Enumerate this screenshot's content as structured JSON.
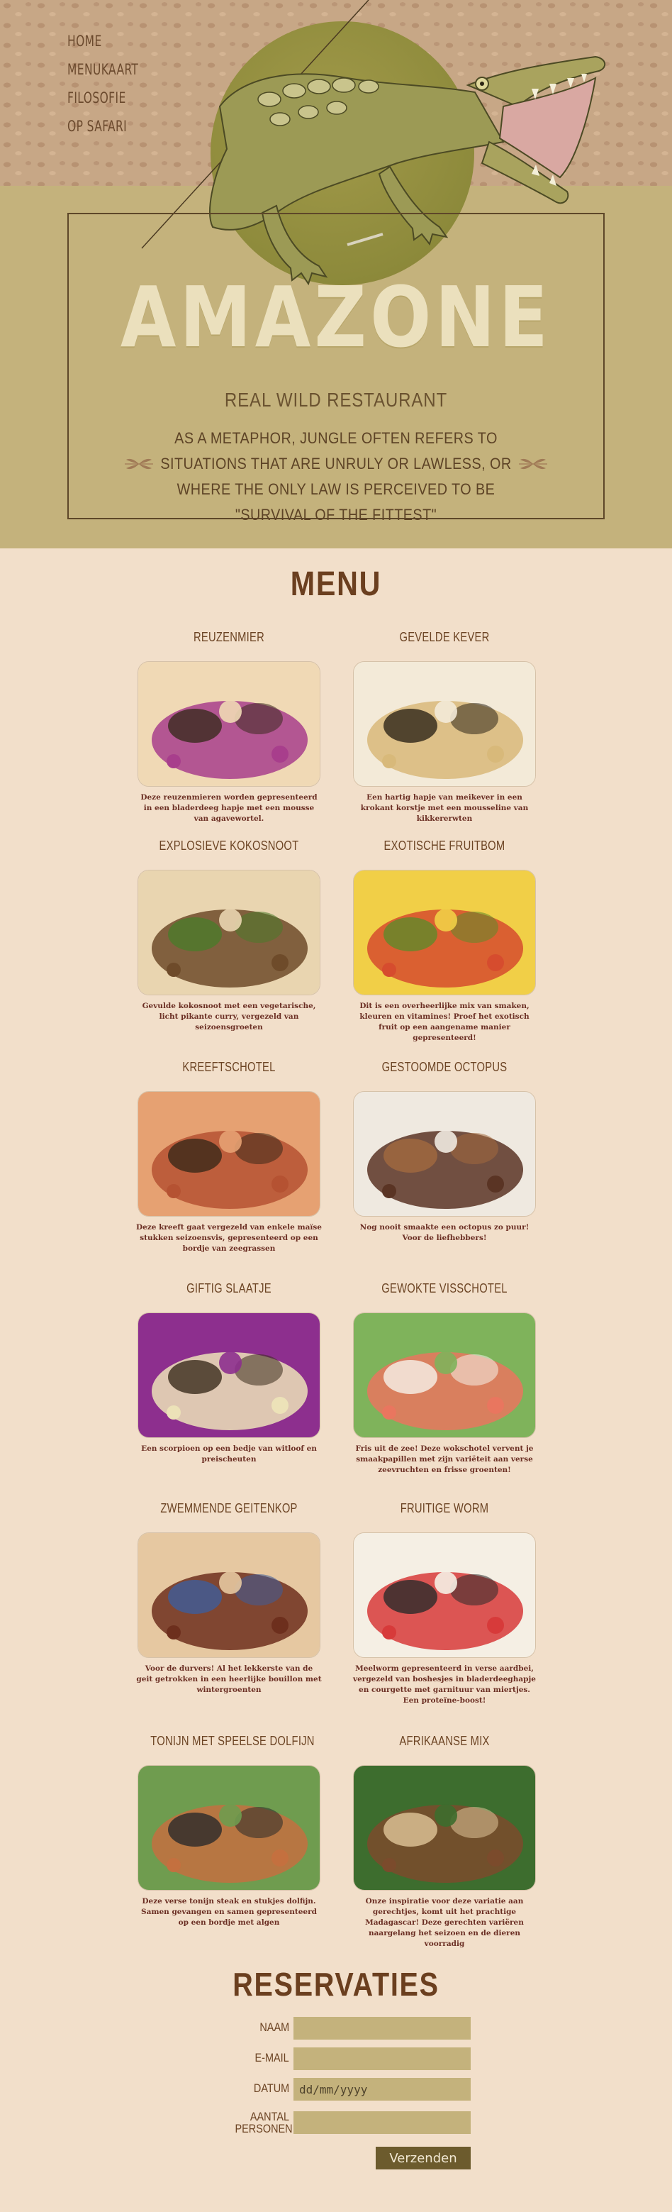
{
  "nav": {
    "items": [
      "HOME",
      "MENUKAART",
      "FILOSOFIE",
      "OP SAFARI"
    ]
  },
  "hero": {
    "title": "AMAZONE",
    "subtitle": "REAL WILD RESTAURANT",
    "quote": "AS A METAPHOR, JUNGLE OFTEN REFERS TO SITUATIONS THAT ARE UNRULY OR LAWLESS, OR WHERE THE ONLY LAW IS PERCEIVED TO BE \"SURVIVAL OF THE FITTEST\""
  },
  "menu": {
    "heading": "MENU",
    "dishes": [
      {
        "name": "REUZENMIER",
        "description": "Deze reuzenmieren worden gepresenteerd in een bladerdeeg hapje met een mousse van agavewortel."
      },
      {
        "name": "GEVELDE KEVER",
        "description": "Een hartig hapje van meikever in een krokant korstje met een mousseline van kikkererwten"
      },
      {
        "name": "EXPLOSIEVE KOKOSNOOT",
        "description": "Gevulde kokosnoot met een vegetarische, licht pikante curry, vergezeld van seizoensgroeten"
      },
      {
        "name": "EXOTISCHE FRUITBOM",
        "description": "Dit is een overheerlijke mix van smaken, kleuren en vitamines! Proef het exotisch fruit op een aangename manier gepresenteerd!"
      },
      {
        "name": "KREEFTSCHOTEL",
        "description": "Deze kreeft gaat vergezeld van enkele maïse stukken seizoensvis, gepresenteerd op een bordje van zeegrassen"
      },
      {
        "name": "GESTOOMDE OCTOPUS",
        "description": "Nog nooit smaakte een octopus zo puur! Voor de liefhebbers!"
      },
      {
        "name": "GIFTIG SLAATJE",
        "description": "Een scorpioen op een bedje van witloof en preischeuten"
      },
      {
        "name": "GEWOKTE VISSCHOTEL",
        "description": "Fris uit de zee! Deze wokschotel vervent je smaakpapillen met zijn variëteit aan verse zeevruchten en frisse groenten!"
      },
      {
        "name": "ZWEMMENDE GEITENKOP",
        "description": "Voor de durvers! Al het lekkerste van de geit getrokken in een heerlijke bouillon met wintergroenten"
      },
      {
        "name": "FRUITIGE WORM",
        "description": "Meelworm gepresenteerd in verse aardbei, vergezeld van boshesjes in bladerdeeghapje en courgette met garnituur van miertjes. Een proteïne-boost!"
      },
      {
        "name": "TONIJN MET SPEELSE DOLFIJN",
        "description": "Deze verse tonijn steak en stukjes dolfijn. Samen gevangen en samen gepresenteerd op een bordje met algen"
      },
      {
        "name": "AFRIKAANSE MIX",
        "description": "Onze inspiratie voor deze variatie aan gerechtjes, komt uit het prachtige Madagascar! Deze gerechten variëren naargelang het seizoen en de dieren voorradig"
      }
    ]
  },
  "reservations": {
    "heading": "RESERVATIES",
    "fields": {
      "name": {
        "label": "NAAM",
        "value": ""
      },
      "email": {
        "label": "E-MAIL",
        "value": ""
      },
      "date": {
        "label": "DATUM",
        "placeholder": "dd/mm/yyyy",
        "value": ""
      },
      "persons": {
        "label": "AANTAL PERSONEN",
        "value": ""
      }
    },
    "submit_label": "Verzenden"
  },
  "colors": {
    "background": "#f2dfca",
    "hero": "#c4b27c",
    "hero_pattern": "#c7a786",
    "circle": "#8d8a3b",
    "heading": "#6b3f1f",
    "description": "#6b2f24",
    "input": "#c4b27c",
    "button": "#6c5b2d"
  }
}
